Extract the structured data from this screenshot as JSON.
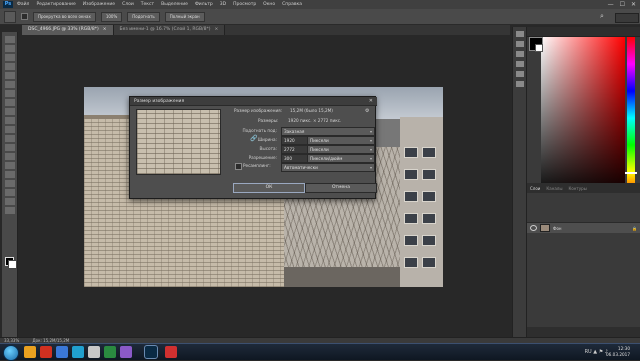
{
  "menu": {
    "logo": "Ps",
    "items": [
      "Файл",
      "Редактирование",
      "Изображение",
      "Слои",
      "Текст",
      "Выделение",
      "Фильтр",
      "3D",
      "Просмотр",
      "Окно",
      "Справка"
    ],
    "min": "—",
    "max": "☐",
    "close": "✕"
  },
  "options": {
    "btn_fit": "Прокрутка во всех окнах",
    "btn_100": "100%",
    "btn_screen": "Подогнать",
    "btn_fill": "Полный экран",
    "search_icon": "⌕"
  },
  "tabs": [
    {
      "label": "DSC_4966.JPG @ 33% (RGB/8*)",
      "close": "×",
      "active": true
    },
    {
      "label": "Без имени-1 @ 16.7% (Слой 1, RGB/8*)",
      "close": "×",
      "active": false
    }
  ],
  "dialog": {
    "title": "Размер изображения",
    "close": "✕",
    "gear": "⚙",
    "size_label": "Размер изображения:",
    "size_value": "15,2M (было 15,2M)",
    "dims_label": "Размеры:",
    "dims_value": "1920 пикс. × 2772 пикс.",
    "fit_label": "Подогнать под:",
    "fit_value": "Заказная",
    "width_label": "Ширина:",
    "width_value": "1920",
    "width_unit": "Пиксели",
    "height_label": "Высота:",
    "height_value": "2772",
    "height_unit": "Пиксели",
    "res_label": "Разрешение:",
    "res_value": "300",
    "res_unit": "Пиксели/дюйм",
    "resample_label": "Ресамплинг:",
    "resample_value": "Автоматически",
    "link_icon": "🔗",
    "ok": "ОК",
    "cancel": "Отмена"
  },
  "panels": {
    "tabs": [
      "Слои",
      "Каналы",
      "Контуры"
    ],
    "layer_name": "Фон",
    "lock": "🔒"
  },
  "status": {
    "zoom": "33,33%",
    "doc": "Док: 15,2M/15,2M"
  },
  "taskbar": {
    "time": "12:30",
    "date": "06.03.2017",
    "tray": "RU ▲ ⚑ ♪"
  },
  "colors": {
    "accent": "#4aa8ff",
    "foreground": "#000000",
    "background": "#ffffff"
  }
}
